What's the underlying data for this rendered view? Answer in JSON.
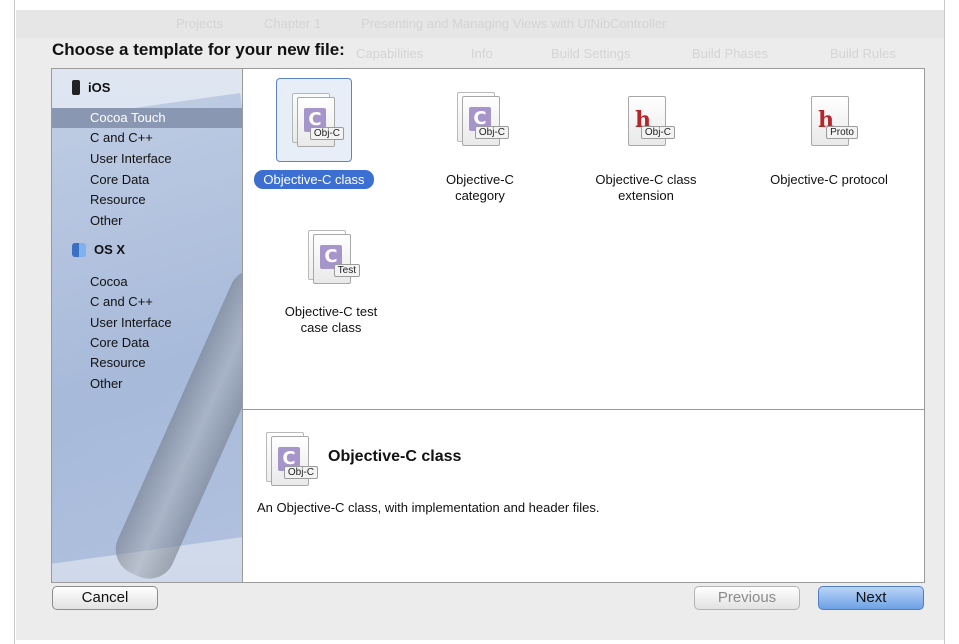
{
  "dialog": {
    "title": "Choose a template for your new file:"
  },
  "background_window": {
    "breadcrumbs": [
      "Projects",
      "Chapter 1",
      "Presenting and Managing Views with UINibController"
    ],
    "tabs": [
      "Capabilities",
      "Info",
      "Build Settings",
      "Build Phases",
      "Build Rules"
    ]
  },
  "sidebar": {
    "sections": [
      {
        "label": "iOS",
        "icon": "iphone-icon",
        "items": [
          "Cocoa Touch",
          "C and C++",
          "User Interface",
          "Core Data",
          "Resource",
          "Other"
        ],
        "selected": "Cocoa Touch"
      },
      {
        "label": "OS X",
        "icon": "finder-icon",
        "items": [
          "Cocoa",
          "C and C++",
          "User Interface",
          "Core Data",
          "Resource",
          "Other"
        ]
      }
    ]
  },
  "templates": [
    {
      "label": "Objective-C class",
      "badge": "Obj-C",
      "letter": "C",
      "selected": true
    },
    {
      "label": "Objective-C category",
      "badge": "Obj-C",
      "letter": "C"
    },
    {
      "label": "Objective-C class extension",
      "badge": "Obj-C",
      "letter": "h"
    },
    {
      "label": "Objective-C protocol",
      "badge": "Proto",
      "letter": "h"
    },
    {
      "label": "Objective-C test case class",
      "badge": "Test",
      "letter": "C"
    }
  ],
  "details": {
    "title": "Objective-C class",
    "badge": "Obj-C",
    "description": "An Objective-C class, with implementation and header files."
  },
  "buttons": {
    "cancel": "Cancel",
    "previous": "Previous",
    "next": "Next"
  },
  "colors": {
    "selection": "#3c6fd1",
    "sidebar_selection": "#8a97b2",
    "next_button": "#6ea1e6"
  }
}
